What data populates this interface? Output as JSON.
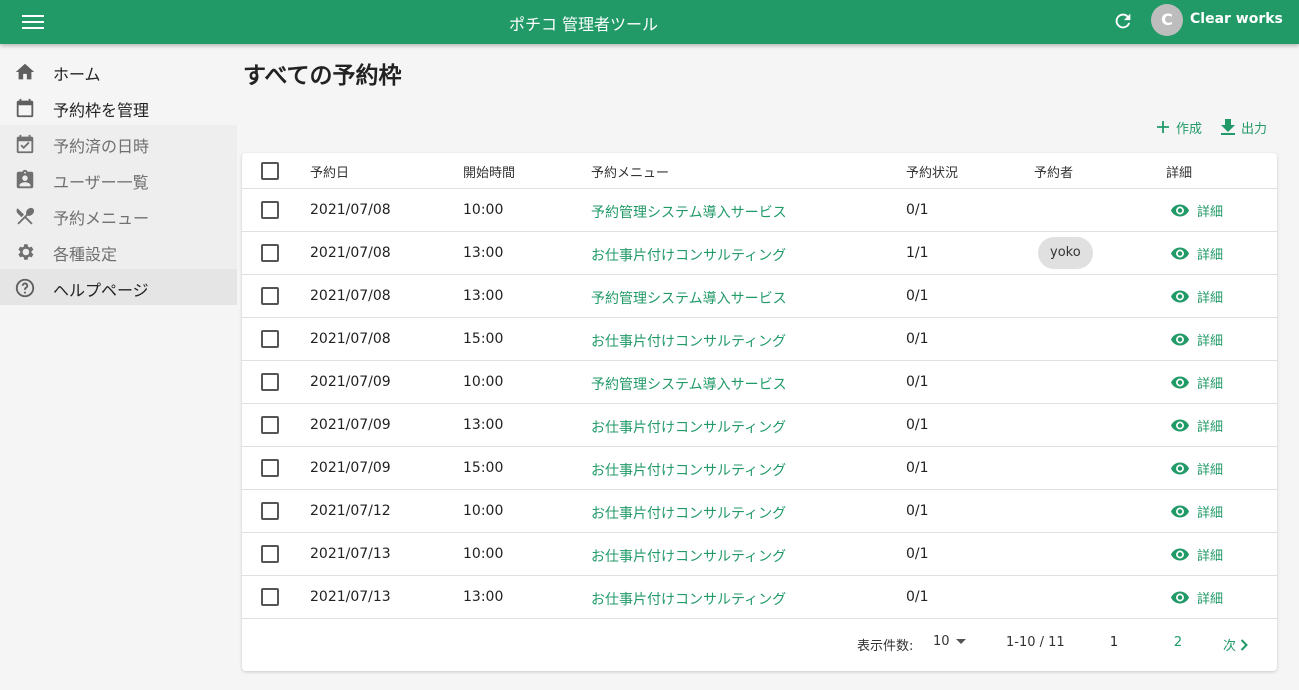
{
  "app": {
    "title": "ポチコ 管理者ツール",
    "user_initial": "C",
    "user_name": "Clear works",
    "accent": "#219a68"
  },
  "sidebar": {
    "items": [
      {
        "label": "ホーム",
        "icon": "home-icon"
      },
      {
        "label": "予約枠を管理",
        "icon": "calendar-icon"
      },
      {
        "label": "予約済の日時",
        "icon": "calendar-check-icon"
      },
      {
        "label": "ユーザー一覧",
        "icon": "clipboard-account-icon"
      },
      {
        "label": "予約メニュー",
        "icon": "utensils-icon"
      },
      {
        "label": "各種設定",
        "icon": "gear-icon"
      },
      {
        "label": "ヘルプページ",
        "icon": "help-circle-icon"
      }
    ]
  },
  "page": {
    "title": "すべての予約枠",
    "create_label": "作成",
    "export_label": "出力"
  },
  "table": {
    "headers": {
      "date": "予約日",
      "time": "開始時間",
      "menu": "予約メニュー",
      "status": "予約状況",
      "booker": "予約者",
      "detail": "詳細"
    },
    "detail_label": "詳細",
    "rows": [
      {
        "date": "2021/07/08",
        "time": "10:00",
        "menu": "予約管理システム導入サービス",
        "status": "0/1",
        "booker": ""
      },
      {
        "date": "2021/07/08",
        "time": "13:00",
        "menu": "お仕事片付けコンサルティング",
        "status": "1/1",
        "booker": "yoko"
      },
      {
        "date": "2021/07/08",
        "time": "13:00",
        "menu": "予約管理システム導入サービス",
        "status": "0/1",
        "booker": ""
      },
      {
        "date": "2021/07/08",
        "time": "15:00",
        "menu": "お仕事片付けコンサルティング",
        "status": "0/1",
        "booker": ""
      },
      {
        "date": "2021/07/09",
        "time": "10:00",
        "menu": "予約管理システム導入サービス",
        "status": "0/1",
        "booker": ""
      },
      {
        "date": "2021/07/09",
        "time": "13:00",
        "menu": "お仕事片付けコンサルティング",
        "status": "0/1",
        "booker": ""
      },
      {
        "date": "2021/07/09",
        "time": "15:00",
        "menu": "お仕事片付けコンサルティング",
        "status": "0/1",
        "booker": ""
      },
      {
        "date": "2021/07/12",
        "time": "10:00",
        "menu": "お仕事片付けコンサルティング",
        "status": "0/1",
        "booker": ""
      },
      {
        "date": "2021/07/13",
        "time": "10:00",
        "menu": "お仕事片付けコンサルティング",
        "status": "0/1",
        "booker": ""
      },
      {
        "date": "2021/07/13",
        "time": "13:00",
        "menu": "お仕事片付けコンサルティング",
        "status": "0/1",
        "booker": ""
      }
    ]
  },
  "pagination": {
    "per_page_label": "表示件数:",
    "per_page_value": "10",
    "range": "1-10 / 11",
    "current_page": "1",
    "other_page": "2",
    "next_label": "次"
  }
}
